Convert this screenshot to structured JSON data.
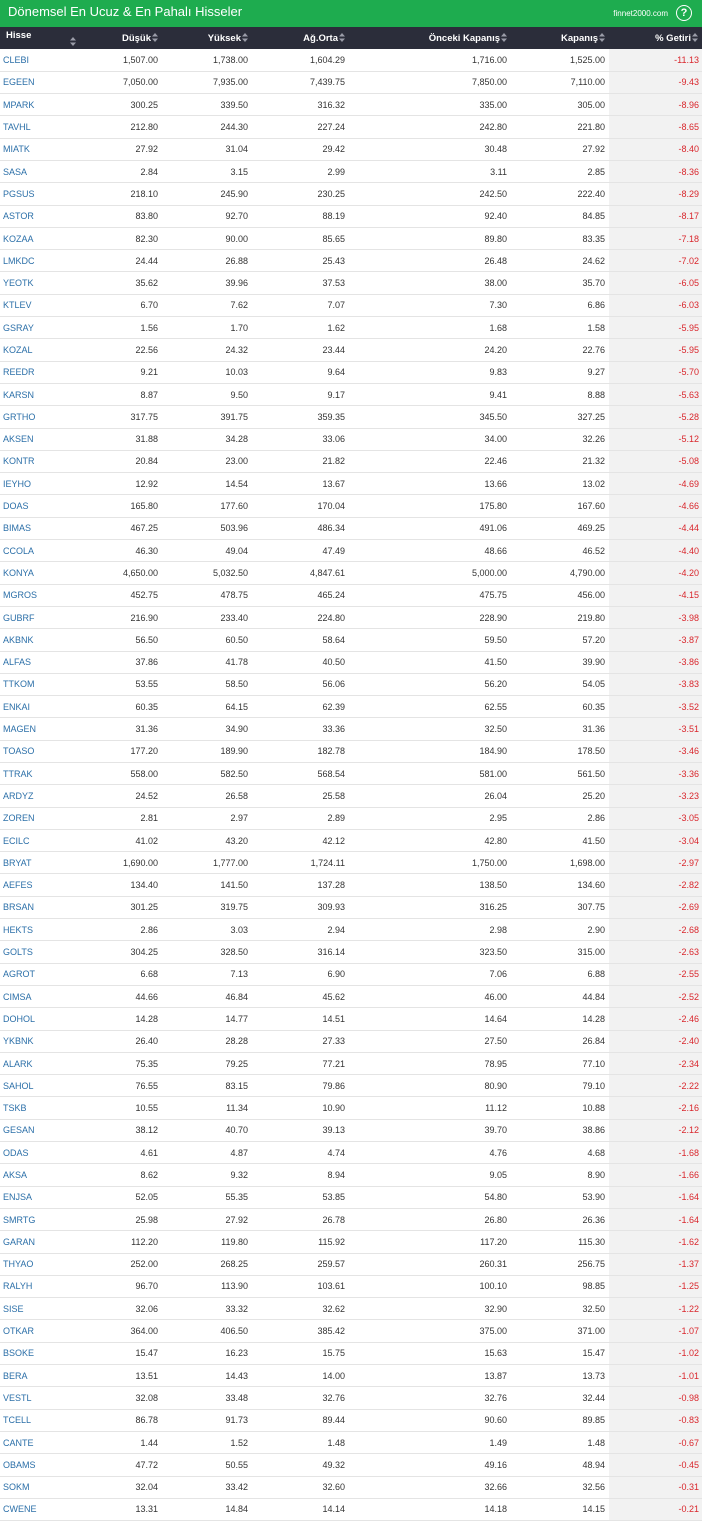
{
  "header": {
    "title": "Dönemsel En Ucuz & En Pahalı Hisseler",
    "brand": "finnet2000.com",
    "help_icon": "?"
  },
  "table": {
    "columns": [
      "Hisse",
      "Düşük",
      "Yüksek",
      "Ağ.Orta",
      "Önceki Kapanış",
      "Kapanış",
      "% Getiri"
    ],
    "rows": [
      [
        "CLEBI",
        "1,507.00",
        "1,738.00",
        "1,604.29",
        "1,716.00",
        "1,525.00",
        "-11.13"
      ],
      [
        "EGEEN",
        "7,050.00",
        "7,935.00",
        "7,439.75",
        "7,850.00",
        "7,110.00",
        "-9.43"
      ],
      [
        "MPARK",
        "300.25",
        "339.50",
        "316.32",
        "335.00",
        "305.00",
        "-8.96"
      ],
      [
        "TAVHL",
        "212.80",
        "244.30",
        "227.24",
        "242.80",
        "221.80",
        "-8.65"
      ],
      [
        "MIATK",
        "27.92",
        "31.04",
        "29.42",
        "30.48",
        "27.92",
        "-8.40"
      ],
      [
        "SASA",
        "2.84",
        "3.15",
        "2.99",
        "3.11",
        "2.85",
        "-8.36"
      ],
      [
        "PGSUS",
        "218.10",
        "245.90",
        "230.25",
        "242.50",
        "222.40",
        "-8.29"
      ],
      [
        "ASTOR",
        "83.80",
        "92.70",
        "88.19",
        "92.40",
        "84.85",
        "-8.17"
      ],
      [
        "KOZAA",
        "82.30",
        "90.00",
        "85.65",
        "89.80",
        "83.35",
        "-7.18"
      ],
      [
        "LMKDC",
        "24.44",
        "26.88",
        "25.43",
        "26.48",
        "24.62",
        "-7.02"
      ],
      [
        "YEOTK",
        "35.62",
        "39.96",
        "37.53",
        "38.00",
        "35.70",
        "-6.05"
      ],
      [
        "KTLEV",
        "6.70",
        "7.62",
        "7.07",
        "7.30",
        "6.86",
        "-6.03"
      ],
      [
        "GSRAY",
        "1.56",
        "1.70",
        "1.62",
        "1.68",
        "1.58",
        "-5.95"
      ],
      [
        "KOZAL",
        "22.56",
        "24.32",
        "23.44",
        "24.20",
        "22.76",
        "-5.95"
      ],
      [
        "REEDR",
        "9.21",
        "10.03",
        "9.64",
        "9.83",
        "9.27",
        "-5.70"
      ],
      [
        "KARSN",
        "8.87",
        "9.50",
        "9.17",
        "9.41",
        "8.88",
        "-5.63"
      ],
      [
        "GRTHO",
        "317.75",
        "391.75",
        "359.35",
        "345.50",
        "327.25",
        "-5.28"
      ],
      [
        "AKSEN",
        "31.88",
        "34.28",
        "33.06",
        "34.00",
        "32.26",
        "-5.12"
      ],
      [
        "KONTR",
        "20.84",
        "23.00",
        "21.82",
        "22.46",
        "21.32",
        "-5.08"
      ],
      [
        "IEYHO",
        "12.92",
        "14.54",
        "13.67",
        "13.66",
        "13.02",
        "-4.69"
      ],
      [
        "DOAS",
        "165.80",
        "177.60",
        "170.04",
        "175.80",
        "167.60",
        "-4.66"
      ],
      [
        "BIMAS",
        "467.25",
        "503.96",
        "486.34",
        "491.06",
        "469.25",
        "-4.44"
      ],
      [
        "CCOLA",
        "46.30",
        "49.04",
        "47.49",
        "48.66",
        "46.52",
        "-4.40"
      ],
      [
        "KONYA",
        "4,650.00",
        "5,032.50",
        "4,847.61",
        "5,000.00",
        "4,790.00",
        "-4.20"
      ],
      [
        "MGROS",
        "452.75",
        "478.75",
        "465.24",
        "475.75",
        "456.00",
        "-4.15"
      ],
      [
        "GUBRF",
        "216.90",
        "233.40",
        "224.80",
        "228.90",
        "219.80",
        "-3.98"
      ],
      [
        "AKBNK",
        "56.50",
        "60.50",
        "58.64",
        "59.50",
        "57.20",
        "-3.87"
      ],
      [
        "ALFAS",
        "37.86",
        "41.78",
        "40.50",
        "41.50",
        "39.90",
        "-3.86"
      ],
      [
        "TTKOM",
        "53.55",
        "58.50",
        "56.06",
        "56.20",
        "54.05",
        "-3.83"
      ],
      [
        "ENKAI",
        "60.35",
        "64.15",
        "62.39",
        "62.55",
        "60.35",
        "-3.52"
      ],
      [
        "MAGEN",
        "31.36",
        "34.90",
        "33.36",
        "32.50",
        "31.36",
        "-3.51"
      ],
      [
        "TOASO",
        "177.20",
        "189.90",
        "182.78",
        "184.90",
        "178.50",
        "-3.46"
      ],
      [
        "TTRAK",
        "558.00",
        "582.50",
        "568.54",
        "581.00",
        "561.50",
        "-3.36"
      ],
      [
        "ARDYZ",
        "24.52",
        "26.58",
        "25.58",
        "26.04",
        "25.20",
        "-3.23"
      ],
      [
        "ZOREN",
        "2.81",
        "2.97",
        "2.89",
        "2.95",
        "2.86",
        "-3.05"
      ],
      [
        "ECILC",
        "41.02",
        "43.20",
        "42.12",
        "42.80",
        "41.50",
        "-3.04"
      ],
      [
        "BRYAT",
        "1,690.00",
        "1,777.00",
        "1,724.11",
        "1,750.00",
        "1,698.00",
        "-2.97"
      ],
      [
        "AEFES",
        "134.40",
        "141.50",
        "137.28",
        "138.50",
        "134.60",
        "-2.82"
      ],
      [
        "BRSAN",
        "301.25",
        "319.75",
        "309.93",
        "316.25",
        "307.75",
        "-2.69"
      ],
      [
        "HEKTS",
        "2.86",
        "3.03",
        "2.94",
        "2.98",
        "2.90",
        "-2.68"
      ],
      [
        "GOLTS",
        "304.25",
        "328.50",
        "316.14",
        "323.50",
        "315.00",
        "-2.63"
      ],
      [
        "AGROT",
        "6.68",
        "7.13",
        "6.90",
        "7.06",
        "6.88",
        "-2.55"
      ],
      [
        "CIMSA",
        "44.66",
        "46.84",
        "45.62",
        "46.00",
        "44.84",
        "-2.52"
      ],
      [
        "DOHOL",
        "14.28",
        "14.77",
        "14.51",
        "14.64",
        "14.28",
        "-2.46"
      ],
      [
        "YKBNK",
        "26.40",
        "28.28",
        "27.33",
        "27.50",
        "26.84",
        "-2.40"
      ],
      [
        "ALARK",
        "75.35",
        "79.25",
        "77.21",
        "78.95",
        "77.10",
        "-2.34"
      ],
      [
        "SAHOL",
        "76.55",
        "83.15",
        "79.86",
        "80.90",
        "79.10",
        "-2.22"
      ],
      [
        "TSKB",
        "10.55",
        "11.34",
        "10.90",
        "11.12",
        "10.88",
        "-2.16"
      ],
      [
        "GESAN",
        "38.12",
        "40.70",
        "39.13",
        "39.70",
        "38.86",
        "-2.12"
      ],
      [
        "ODAS",
        "4.61",
        "4.87",
        "4.74",
        "4.76",
        "4.68",
        "-1.68"
      ],
      [
        "AKSA",
        "8.62",
        "9.32",
        "8.94",
        "9.05",
        "8.90",
        "-1.66"
      ],
      [
        "ENJSA",
        "52.05",
        "55.35",
        "53.85",
        "54.80",
        "53.90",
        "-1.64"
      ],
      [
        "SMRTG",
        "25.98",
        "27.92",
        "26.78",
        "26.80",
        "26.36",
        "-1.64"
      ],
      [
        "GARAN",
        "112.20",
        "119.80",
        "115.92",
        "117.20",
        "115.30",
        "-1.62"
      ],
      [
        "THYAO",
        "252.00",
        "268.25",
        "259.57",
        "260.31",
        "256.75",
        "-1.37"
      ],
      [
        "RALYH",
        "96.70",
        "113.90",
        "103.61",
        "100.10",
        "98.85",
        "-1.25"
      ],
      [
        "SISE",
        "32.06",
        "33.32",
        "32.62",
        "32.90",
        "32.50",
        "-1.22"
      ],
      [
        "OTKAR",
        "364.00",
        "406.50",
        "385.42",
        "375.00",
        "371.00",
        "-1.07"
      ],
      [
        "BSOKE",
        "15.47",
        "16.23",
        "15.75",
        "15.63",
        "15.47",
        "-1.02"
      ],
      [
        "BERA",
        "13.51",
        "14.43",
        "14.00",
        "13.87",
        "13.73",
        "-1.01"
      ],
      [
        "VESTL",
        "32.08",
        "33.48",
        "32.76",
        "32.76",
        "32.44",
        "-0.98"
      ],
      [
        "TCELL",
        "86.78",
        "91.73",
        "89.44",
        "90.60",
        "89.85",
        "-0.83"
      ],
      [
        "CANTE",
        "1.44",
        "1.52",
        "1.48",
        "1.49",
        "1.48",
        "-0.67"
      ],
      [
        "OBAMS",
        "47.72",
        "50.55",
        "49.32",
        "49.16",
        "48.94",
        "-0.45"
      ],
      [
        "SOKM",
        "32.04",
        "33.42",
        "32.60",
        "32.66",
        "32.56",
        "-0.31"
      ],
      [
        "CWENE",
        "13.31",
        "14.84",
        "14.14",
        "14.18",
        "14.15",
        "-0.21"
      ]
    ]
  },
  "colors": {
    "header_bg": "#1eac4f",
    "table_header_bg": "#2b2d3a",
    "symbol_link": "#2b6fa8",
    "negative_return": "#d9262c"
  },
  "icons": {
    "sort": "sort-arrows-icon",
    "help": "help-circle-icon"
  }
}
